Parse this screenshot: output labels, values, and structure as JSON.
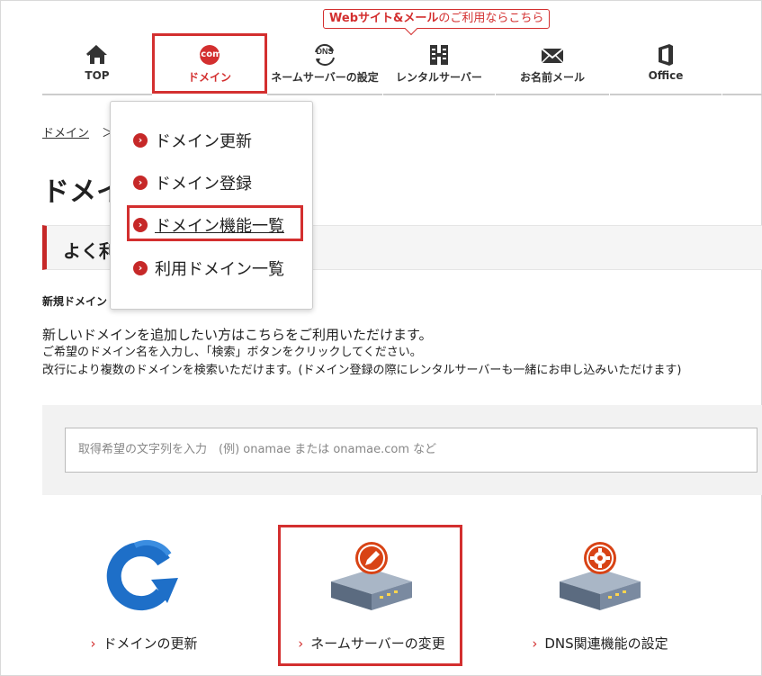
{
  "promo": {
    "text_bold1": "Webサイト",
    "text_bold2": "&メール",
    "text_rest": "のご利用ならこちら"
  },
  "nav": {
    "items": [
      {
        "label": "TOP",
        "icon": "home-icon"
      },
      {
        "label": "ドメイン",
        "icon": "dotcom-icon",
        "icon_text": ".com"
      },
      {
        "label": "ネームサーバーの設定",
        "icon": "dns-icon",
        "icon_text": "DNS"
      },
      {
        "label": "レンタルサーバー",
        "icon": "server-icon"
      },
      {
        "label": "お名前メール",
        "icon": "mail-icon"
      },
      {
        "label": "Office",
        "icon": "office-icon"
      }
    ]
  },
  "dropdown": {
    "items": [
      {
        "label": "ドメイン更新"
      },
      {
        "label": "ドメイン登録"
      },
      {
        "label": "ドメイン機能一覧"
      },
      {
        "label": "利用ドメイン一覧"
      }
    ]
  },
  "breadcrumb": {
    "link": "ドメイン",
    "separator": "＞"
  },
  "page": {
    "title": "ドメイン",
    "section_title": "よく利",
    "sub_title": "新規ドメイン"
  },
  "description": {
    "line1": "新しいドメインを追加したい方はこちらをご利用いただけます。",
    "line2": "ご希望のドメイン名を入力し、「検索」ボタンをクリックしてください。",
    "line3": "改行により複数のドメインを検索いただけます。(ドメイン登録の際にレンタルサーバーも一緒にお申し込みいただけます)"
  },
  "search": {
    "placeholder": "取得希望の文字列を入力　(例) onamae または onamae.com など"
  },
  "tiles": [
    {
      "label": "ドメインの更新",
      "icon": "renew-arrow-icon"
    },
    {
      "label": "ネームサーバーの変更",
      "icon": "server-edit-icon"
    },
    {
      "label": "DNS関連機能の設定",
      "icon": "server-gear-icon"
    }
  ],
  "colors": {
    "accent": "#d32f2f",
    "blue": "#1e6fc8"
  }
}
